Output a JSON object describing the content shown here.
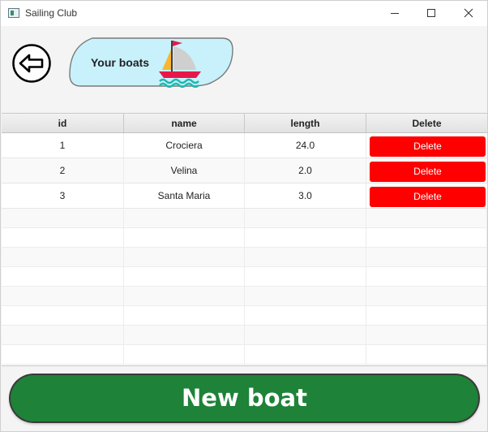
{
  "window": {
    "title": "Sailing Club"
  },
  "header": {
    "label": "Your boats"
  },
  "icons": {
    "back": "back-arrow-icon",
    "boat": "sailboat-icon"
  },
  "colors": {
    "delete": "#ff0000",
    "new_boat": "#1e8238",
    "pill": "#c8f1fb"
  },
  "table": {
    "columns": [
      "id",
      "name",
      "length",
      "Delete"
    ],
    "rows": [
      {
        "id": "1",
        "name": "Crociera",
        "length": "24.0",
        "action": "Delete"
      },
      {
        "id": "2",
        "name": "Velina",
        "length": "2.0",
        "action": "Delete"
      },
      {
        "id": "3",
        "name": "Santa Maria",
        "length": "3.0",
        "action": "Delete"
      }
    ]
  },
  "footer": {
    "new_boat_label": "New boat"
  }
}
